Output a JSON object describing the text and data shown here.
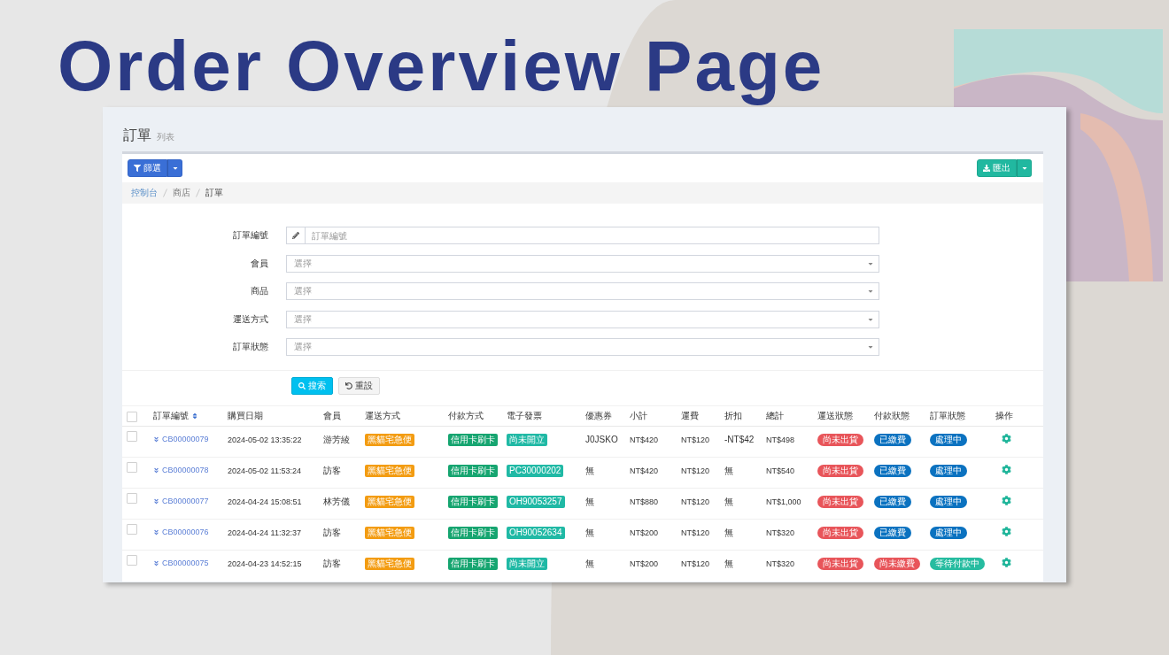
{
  "slide": {
    "title": "Order Overview Page"
  },
  "page_header": {
    "title": "訂單",
    "subtitle": "列表"
  },
  "toolbar": {
    "filter_button": {
      "label": "篩選"
    },
    "export_button": {
      "label": "匯出"
    }
  },
  "breadcrumb": [
    {
      "label": "控制台",
      "kind": "link"
    },
    {
      "label": "商店",
      "kind": "text"
    },
    {
      "label": "訂單",
      "kind": "current"
    }
  ],
  "filter_form": {
    "fields": [
      {
        "label": "訂單編號",
        "kind": "text",
        "placeholder": "訂單編號"
      },
      {
        "label": "會員",
        "kind": "select",
        "placeholder": "選擇"
      },
      {
        "label": "商品",
        "kind": "select",
        "placeholder": "選擇"
      },
      {
        "label": "運送方式",
        "kind": "select",
        "placeholder": "選擇"
      },
      {
        "label": "訂單狀態",
        "kind": "select",
        "placeholder": "選擇"
      }
    ],
    "buttons": [
      {
        "label": "搜索",
        "kind": "search"
      },
      {
        "label": "重設",
        "kind": "reset"
      }
    ]
  },
  "table": {
    "select_all": {
      "checked": false
    },
    "columns": [
      {
        "label": "訂單編號",
        "sortable": true
      },
      {
        "label": "購買日期",
        "sortable": false
      },
      {
        "label": "會員",
        "sortable": false
      },
      {
        "label": "運送方式",
        "sortable": false
      },
      {
        "label": "付款方式",
        "sortable": false
      },
      {
        "label": "電子發票",
        "sortable": false
      },
      {
        "label": "優惠券",
        "sortable": false
      },
      {
        "label": "小計",
        "sortable": false
      },
      {
        "label": "運費",
        "sortable": false
      },
      {
        "label": "折扣",
        "sortable": false
      },
      {
        "label": "總計",
        "sortable": false
      },
      {
        "label": "運送狀態",
        "sortable": false
      },
      {
        "label": "付款狀態",
        "sortable": false
      },
      {
        "label": "訂單狀態",
        "sortable": false
      },
      {
        "label": "操作",
        "sortable": false
      }
    ],
    "rows": [
      {
        "checked": false,
        "order_no": "CB00000079",
        "date": "2024-05-02 13:35:22",
        "member": "游芳綾",
        "shipping_method": "黑貓宅急便",
        "payment_method": "信用卡刷卡",
        "invoice": "尚未開立",
        "coupon": "J0JSKO",
        "subtotal": "NT$420",
        "shipping_fee": "NT$120",
        "discount": "-NT$42",
        "total": "NT$498",
        "shipping_status": {
          "text": "尚未出貨",
          "color": "#e8555a"
        },
        "payment_status": {
          "text": "已繳費",
          "color": "#0b72c0"
        },
        "order_status": {
          "text": "處理中",
          "color": "#0b72c0"
        }
      },
      {
        "checked": false,
        "order_no": "CB00000078",
        "date": "2024-05-02 11:53:24",
        "member": "訪客",
        "shipping_method": "黑貓宅急便",
        "payment_method": "信用卡刷卡",
        "invoice": "PC30000202",
        "coupon": "無",
        "subtotal": "NT$420",
        "shipping_fee": "NT$120",
        "discount": "無",
        "total": "NT$540",
        "shipping_status": {
          "text": "尚未出貨",
          "color": "#e8555a"
        },
        "payment_status": {
          "text": "已繳費",
          "color": "#0b72c0"
        },
        "order_status": {
          "text": "處理中",
          "color": "#0b72c0"
        }
      },
      {
        "checked": false,
        "order_no": "CB00000077",
        "date": "2024-04-24 15:08:51",
        "member": "林芳儀",
        "shipping_method": "黑貓宅急便",
        "payment_method": "信用卡刷卡",
        "invoice": "OH90053257",
        "coupon": "無",
        "subtotal": "NT$880",
        "shipping_fee": "NT$120",
        "discount": "無",
        "total": "NT$1,000",
        "shipping_status": {
          "text": "尚未出貨",
          "color": "#e8555a"
        },
        "payment_status": {
          "text": "已繳費",
          "color": "#0b72c0"
        },
        "order_status": {
          "text": "處理中",
          "color": "#0b72c0"
        }
      },
      {
        "checked": false,
        "order_no": "CB00000076",
        "date": "2024-04-24 11:32:37",
        "member": "訪客",
        "shipping_method": "黑貓宅急便",
        "payment_method": "信用卡刷卡",
        "invoice": "OH90052634",
        "coupon": "無",
        "subtotal": "NT$200",
        "shipping_fee": "NT$120",
        "discount": "無",
        "total": "NT$320",
        "shipping_status": {
          "text": "尚未出貨",
          "color": "#e8555a"
        },
        "payment_status": {
          "text": "已繳費",
          "color": "#0b72c0"
        },
        "order_status": {
          "text": "處理中",
          "color": "#0b72c0"
        }
      },
      {
        "checked": false,
        "order_no": "CB00000075",
        "date": "2024-04-23 14:52:15",
        "member": "訪客",
        "shipping_method": "黑貓宅急便",
        "payment_method": "信用卡刷卡",
        "invoice": "尚未開立",
        "coupon": "無",
        "subtotal": "NT$200",
        "shipping_fee": "NT$120",
        "discount": "無",
        "total": "NT$320",
        "shipping_status": {
          "text": "尚未出貨",
          "color": "#e8555a"
        },
        "payment_status": {
          "text": "尚未繳費",
          "color": "#e8555a"
        },
        "order_status": {
          "text": "等待付款中",
          "color": "#26bca0"
        }
      }
    ]
  }
}
